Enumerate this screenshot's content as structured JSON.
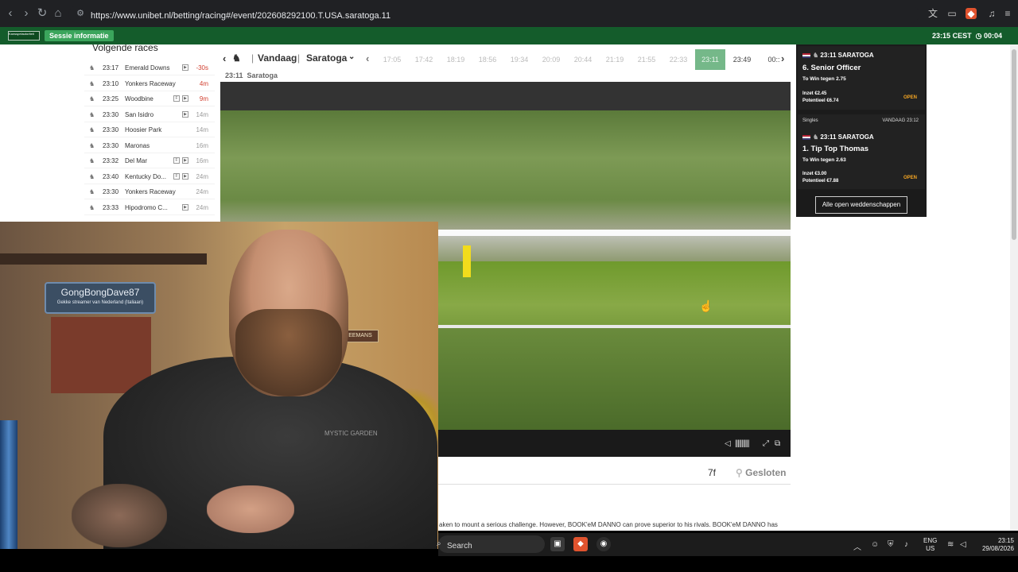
{
  "browser": {
    "url": "https://www.unibet.nl/betting/racing#/event/202608292100.T.USA.saratoga.11"
  },
  "header": {
    "logo_text": "Kansspelautoriteit",
    "session_label": "Sessie informatie",
    "time_label": "23:15 CEST",
    "session_timer": "00:04"
  },
  "next_races": {
    "title": "Volgende races",
    "items": [
      {
        "time": "23:17",
        "name": "Emerald Downs",
        "minutes": "-30s",
        "soon": true
      },
      {
        "time": "23:10",
        "name": "Yonkers Raceway",
        "minutes": "4m",
        "soon": true
      },
      {
        "time": "23:25",
        "name": "Woodbine",
        "minutes": "9m",
        "soon": true
      },
      {
        "time": "23:30",
        "name": "San Isidro",
        "minutes": "14m",
        "soon": false
      },
      {
        "time": "23:30",
        "name": "Hoosier Park",
        "minutes": "14m",
        "soon": false
      },
      {
        "time": "23:30",
        "name": "Maronas",
        "minutes": "16m",
        "soon": false
      },
      {
        "time": "23:32",
        "name": "Del Mar",
        "minutes": "16m",
        "soon": false
      },
      {
        "time": "23:40",
        "name": "Kentucky Do...",
        "minutes": "24m",
        "soon": false
      },
      {
        "time": "23:30",
        "name": "Yonkers Raceway",
        "minutes": "24m",
        "soon": false
      },
      {
        "time": "23:33",
        "name": "Hipodromo C...",
        "minutes": "24m",
        "soon": false
      }
    ]
  },
  "race_nav": {
    "day": "Vandaag",
    "track": "Saratoga",
    "times": [
      "17:05",
      "17:42",
      "18:19",
      "18:56",
      "19:34",
      "20:09",
      "20:44",
      "21:19",
      "21:55",
      "22:33",
      "23:11",
      "23:49",
      "00::"
    ],
    "active_index": 10,
    "sub_time": "23:11",
    "sub_track": "Saratoga"
  },
  "race_info": {
    "distance": "7f",
    "status": "Gesloten",
    "description": "aken to mount a serious challenge. However, BOOK'eM DANNO can prove superior to his rivals. BOOK'eM DANNO has"
  },
  "bet_slip": {
    "bets": [
      {
        "race": "23:11 SARATOGA",
        "selection": "6. Senior Officer",
        "odds": "To Win tegen 2.75",
        "stake": "Inzet €2.45",
        "potential": "Potentieel €6.74",
        "status": "OPEN",
        "type": "",
        "date": ""
      },
      {
        "race": "23:11 SARATOGA",
        "selection": "1. Tip Top Thomas",
        "odds": "To Win tegen 2.63",
        "stake": "Inzet €3.00",
        "potential": "Potentieel €7.88",
        "status": "OPEN",
        "type": "Singles",
        "date": "VANDAAG 23:12"
      }
    ],
    "all_open_label": "Alle open weddenschappen"
  },
  "webcam": {
    "sign_name": "GongBongDave87",
    "sign_sub": "Gekke streamer van Nederland (Italiaan)",
    "frame_text": "EEMANS",
    "hoodie_text": "MYSTIC GARDEN"
  },
  "taskbar": {
    "search_label": "Search",
    "lang_top": "ENG",
    "lang_bottom": "US",
    "time": "23:15",
    "date": "29/08/2026"
  }
}
